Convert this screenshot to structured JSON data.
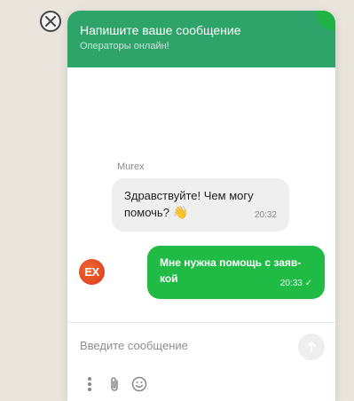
{
  "header": {
    "title": "Напишите ваше сообщение",
    "subtitle": "Операторы онлайн!"
  },
  "chat": {
    "operator_name": "Murex",
    "avatar_text": "EX",
    "messages": [
      {
        "from": "operator",
        "text": "Здравствуйте! Чем могу помочь?",
        "emoji": "👋",
        "time": "20:32"
      },
      {
        "from": "user",
        "text": "Мне нужна помощь с заяв­кой",
        "time": "20:33",
        "status": "✓"
      }
    ]
  },
  "composer": {
    "placeholder": "Введите сообщение"
  },
  "icons": {
    "close": "close-icon",
    "send": "arrow-up-icon",
    "more": "more-vertical-icon",
    "attach": "paperclip-icon",
    "emoji": "smile-icon"
  },
  "colors": {
    "header": "#2ea36a",
    "user_bubble": "#1fbb45",
    "operator_bubble": "#efefef"
  }
}
